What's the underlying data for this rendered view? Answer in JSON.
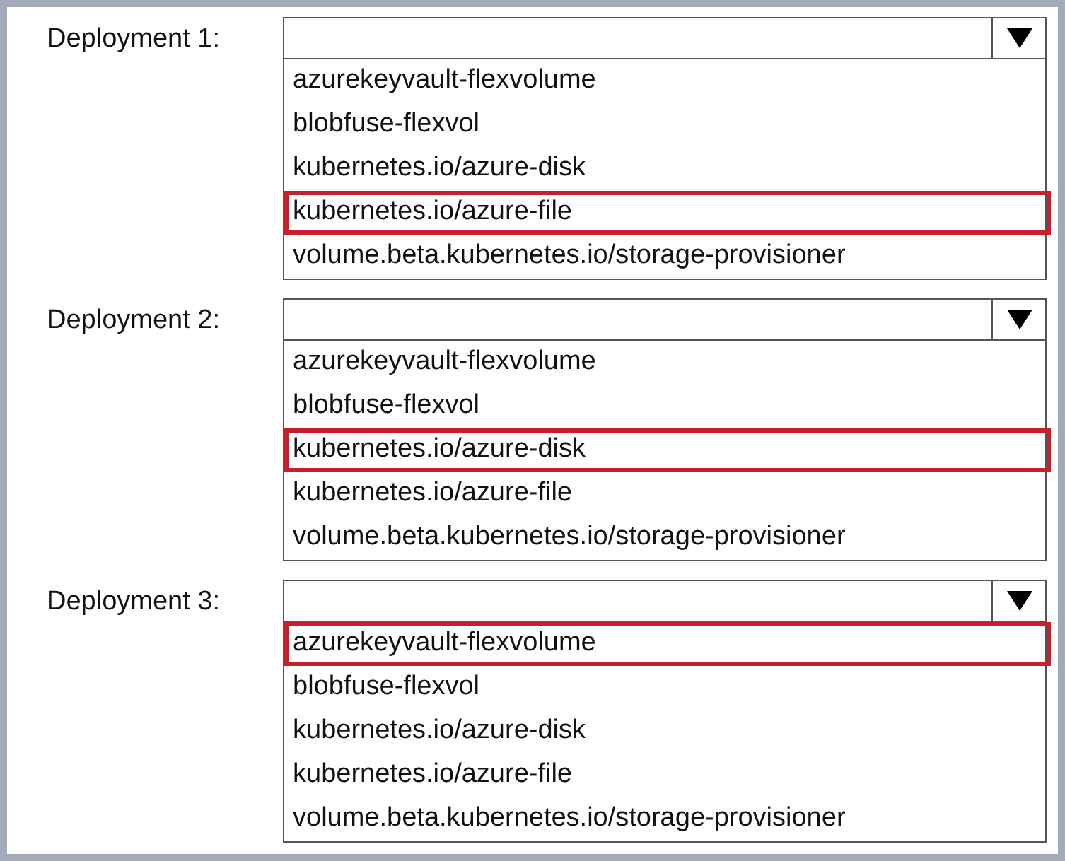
{
  "deployments": [
    {
      "label": "Deployment 1:",
      "options": [
        {
          "text": "azurekeyvault-flexvolume",
          "selected": false
        },
        {
          "text": "blobfuse-flexvol",
          "selected": false
        },
        {
          "text": "kubernetes.io/azure-disk",
          "selected": false
        },
        {
          "text": "kubernetes.io/azure-file",
          "selected": true
        },
        {
          "text": "volume.beta.kubernetes.io/storage-provisioner",
          "selected": false
        }
      ]
    },
    {
      "label": "Deployment 2:",
      "options": [
        {
          "text": "azurekeyvault-flexvolume",
          "selected": false
        },
        {
          "text": "blobfuse-flexvol",
          "selected": false
        },
        {
          "text": "kubernetes.io/azure-disk",
          "selected": true
        },
        {
          "text": "kubernetes.io/azure-file",
          "selected": false
        },
        {
          "text": "volume.beta.kubernetes.io/storage-provisioner",
          "selected": false
        }
      ]
    },
    {
      "label": "Deployment 3:",
      "options": [
        {
          "text": "azurekeyvault-flexvolume",
          "selected": true
        },
        {
          "text": "blobfuse-flexvol",
          "selected": false
        },
        {
          "text": "kubernetes.io/azure-disk",
          "selected": false
        },
        {
          "text": "kubernetes.io/azure-file",
          "selected": false
        },
        {
          "text": "volume.beta.kubernetes.io/storage-provisioner",
          "selected": false
        }
      ]
    }
  ]
}
